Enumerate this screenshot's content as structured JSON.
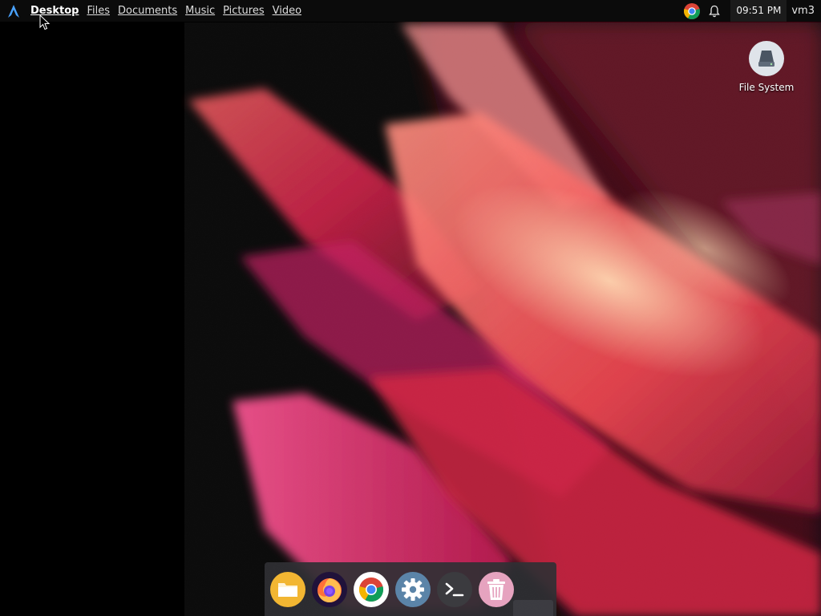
{
  "top_panel": {
    "places": [
      {
        "label": "Desktop",
        "active": true
      },
      {
        "label": "Files",
        "active": false
      },
      {
        "label": "Documents",
        "active": false
      },
      {
        "label": "Music",
        "active": false
      },
      {
        "label": "Pictures",
        "active": false
      },
      {
        "label": "Video",
        "active": false
      }
    ],
    "tray": {
      "icons": [
        "chrome-icon",
        "notification-bell-icon"
      ],
      "clock": "09:51 PM",
      "user": "vm3"
    }
  },
  "desktop_icons": [
    {
      "label": "File System",
      "icon": "drive-icon"
    }
  ],
  "dock": {
    "items": [
      {
        "name": "files",
        "icon": "folder-icon"
      },
      {
        "name": "firefox",
        "icon": "firefox-icon"
      },
      {
        "name": "chrome",
        "icon": "chrome-icon"
      },
      {
        "name": "settings",
        "icon": "gear-icon"
      },
      {
        "name": "terminal",
        "icon": "terminal-icon"
      },
      {
        "name": "trash",
        "icon": "trash-icon"
      }
    ]
  },
  "colors": {
    "panel_bg": "#0b0b0b",
    "dock_bg": "#303034",
    "accent_red": "#e0303f",
    "accent_pink": "#e2377a"
  }
}
